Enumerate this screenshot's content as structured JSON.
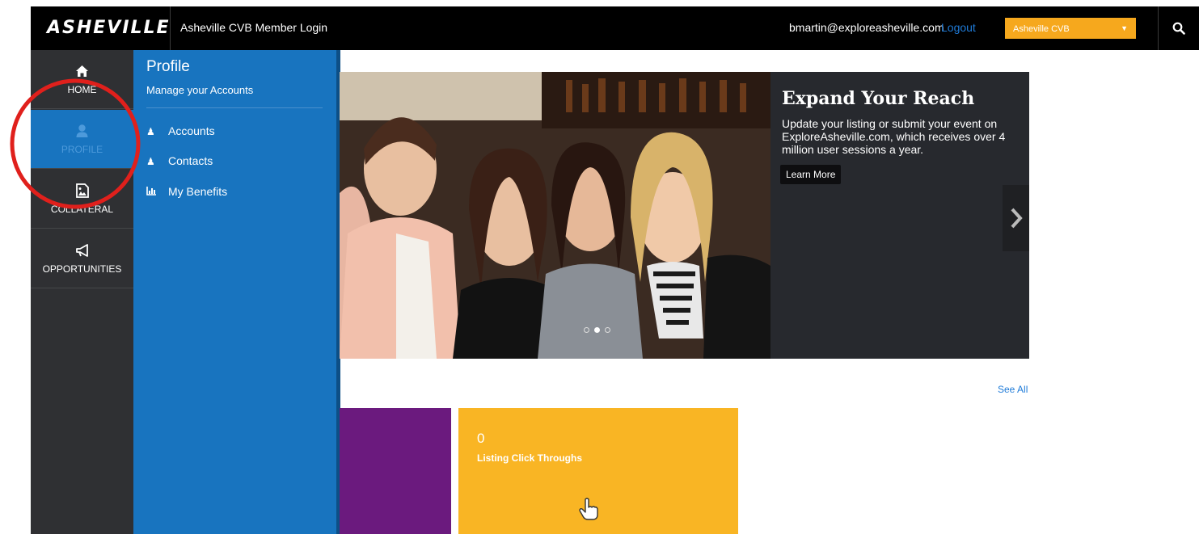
{
  "header": {
    "logo_text": "ASHEVILLE",
    "site_title": "Asheville CVB Member Login",
    "user_email": "bmartin@exploreasheville.com",
    "logout_label": "Logout",
    "account_selected": "Asheville CVB"
  },
  "nav": {
    "items": [
      {
        "label": "HOME",
        "icon": "home-icon"
      },
      {
        "label": "PROFILE",
        "icon": "user-icon"
      },
      {
        "label": "COLLATERAL",
        "icon": "image-file-icon"
      },
      {
        "label": "OPPORTUNITIES",
        "icon": "megaphone-icon"
      }
    ],
    "active": "PROFILE"
  },
  "flyout": {
    "title": "Profile",
    "subtitle": "Manage your Accounts",
    "items": [
      {
        "label": "Accounts",
        "icon": "user-icon"
      },
      {
        "label": "Contacts",
        "icon": "user-icon"
      },
      {
        "label": "My Benefits",
        "icon": "bar-chart-icon"
      }
    ]
  },
  "hero": {
    "title": "Expand Your Reach",
    "body": "Update your listing or submit your event on ExploreAsheville.com, which receives over 4 million user sessions a year.",
    "button_label": "Learn More",
    "slide_count": 3,
    "active_slide": 2
  },
  "see_all_label": "See All",
  "tiles": [
    {
      "count": "",
      "label": "",
      "color": "#6b1a7e"
    },
    {
      "count": "0",
      "label": "Listing Click Throughs",
      "color": "#f9b524",
      "icon": "pointer-hand-icon"
    }
  ],
  "colors": {
    "topbar": "#000000",
    "sidebar": "#2f3033",
    "flyout": "#1874bf",
    "accent_orange": "#f6a81d",
    "link_blue": "#1f7bd8",
    "annotation_red": "#e0201c"
  }
}
